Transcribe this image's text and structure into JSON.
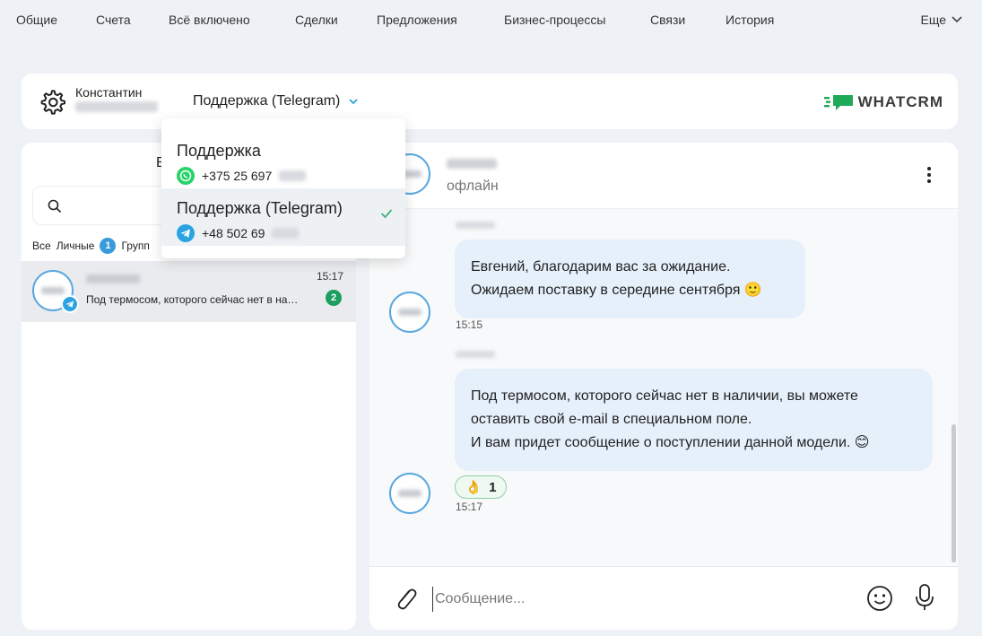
{
  "nav": {
    "items": [
      "Общие",
      "Счета",
      "Всё включено",
      "Сделки",
      "Предложения",
      "Бизнес-процессы",
      "Связи",
      "История"
    ],
    "more": "Еще"
  },
  "header": {
    "user_name": "Константин",
    "channel": "Поддержка (Telegram)",
    "brand": "WHATCRM",
    "brand_color": "#1faa59"
  },
  "dropdown": {
    "items": [
      {
        "name": "Поддержка",
        "phone": "+375 25 697",
        "messenger": "whatsapp-icon",
        "selected": false
      },
      {
        "name": "Поддержка (Telegram)",
        "phone": "+48 502 69",
        "messenger": "telegram-icon",
        "selected": true
      }
    ]
  },
  "left": {
    "title_visible": "В",
    "filters": {
      "all": "Все",
      "personal": "Личные",
      "personal_count": "1",
      "groups": "Групп"
    },
    "chat": {
      "time": "15:17",
      "preview": "Под термосом, которого сейчас нет в на…",
      "unread": "2"
    }
  },
  "conversation": {
    "status": "офлайн",
    "messages": [
      {
        "lines": [
          "Евгений, благодарим вас за ожидание.",
          "Ожидаем поставку в середине сентября 🙂"
        ],
        "time": "15:15"
      },
      {
        "lines": [
          "Под термосом, которого сейчас нет в наличии, вы можете",
          "оставить свой e-mail в специальном поле.",
          "И вам придет сообщение о поступлении данной модели. 😊"
        ],
        "time": "15:17",
        "reaction": {
          "emoji": "👌",
          "count": "1"
        }
      }
    ],
    "composer_placeholder": "Сообщение..."
  },
  "colors": {
    "accent": "#3a9bdc",
    "telegram": "#2aa3e0",
    "whatsapp": "#25d366",
    "bubble": "#e6f0fb",
    "unread": "#1b9e5f"
  }
}
